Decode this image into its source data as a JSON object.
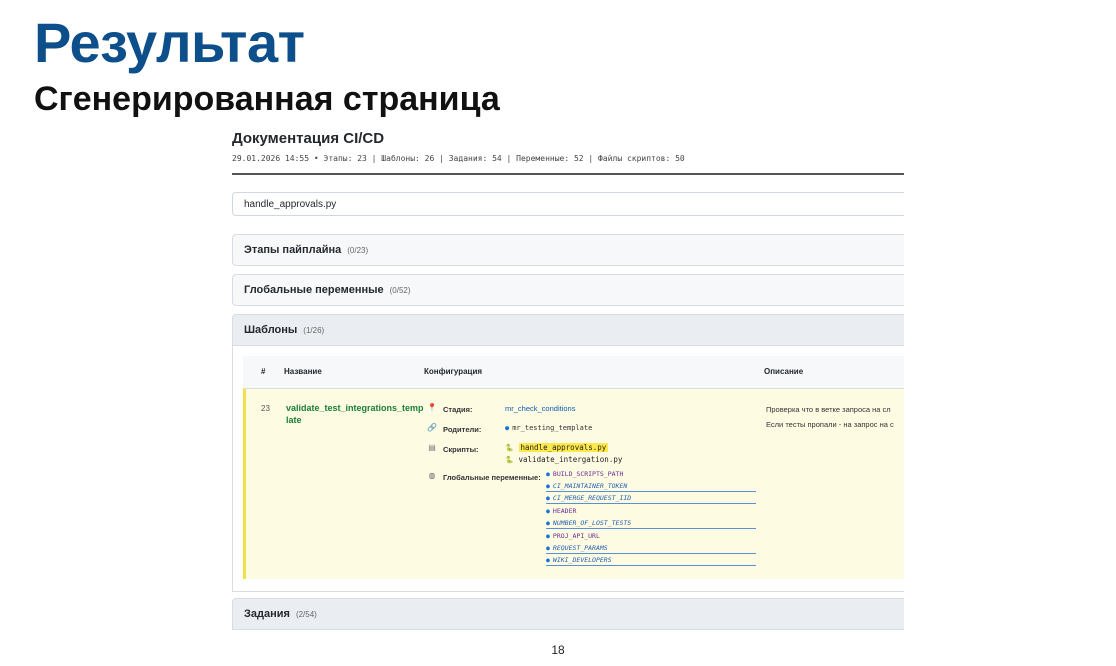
{
  "slide": {
    "title": "Результат",
    "subtitle": "Сгенерированная страница",
    "page_number": "18"
  },
  "doc": {
    "title": "Документация CI/CD",
    "meta": "29.01.2026 14:55 • Этапы: 23 | Шаблоны: 26 | Задания: 54 | Переменные: 52 | Файлы скриптов: 50",
    "search_value": "handle_approvals.py"
  },
  "sections": [
    {
      "label": "Этапы пайплайна",
      "count": "(0/23)"
    },
    {
      "label": "Глобальные переменные",
      "count": "(0/52)"
    },
    {
      "label": "Шаблоны",
      "count": "(1/26)"
    },
    {
      "label": "Задания",
      "count": "(2/54)"
    }
  ],
  "table": {
    "headers": {
      "num": "#",
      "name": "Название",
      "config": "Конфигурация",
      "desc": "Описание"
    },
    "row": {
      "num": "23",
      "name": "validate_test_integrations_template",
      "stage_label": "Стадия:",
      "stage_value": "mr_check_conditions",
      "parents_label": "Родители:",
      "parent_value": "mr_testing_template",
      "scripts_label": "Скрипты:",
      "scripts": [
        "handle_approvals.py",
        "validate_intergation.py"
      ],
      "globals_label": "Глобальные переменные:",
      "globals": [
        {
          "name": "BUILD_SCRIPTS_PATH",
          "style": "plain"
        },
        {
          "name": "CI_MAINTAINER_TOKEN",
          "style": "italic"
        },
        {
          "name": "CI_MERGE_REQUEST_IID",
          "style": "italic"
        },
        {
          "name": "HEADER",
          "style": "plain"
        },
        {
          "name": "NUMBER_OF_LOST_TESTS",
          "style": "italic"
        },
        {
          "name": "PROJ_API_URL",
          "style": "plain"
        },
        {
          "name": "REQUEST_PARAMS",
          "style": "italic"
        },
        {
          "name": "WIKI_DEVELOPERS",
          "style": "italic"
        }
      ],
      "desc_lines": [
        "Проверка что в ветке запроса на сл",
        "Если тесты пропали - на запрос на с"
      ]
    }
  },
  "icons": {
    "stage": "pin-icon",
    "parents": "link-icon",
    "scripts": "script-icon",
    "globals": "globe-icon",
    "script_file": "python-file-icon"
  },
  "colors": {
    "title": "#0d4f8b",
    "name_link": "#1a7f37",
    "value_link": "#0b5cad",
    "highlight": "#ffe94a",
    "row_bg": "#fefbe3"
  }
}
